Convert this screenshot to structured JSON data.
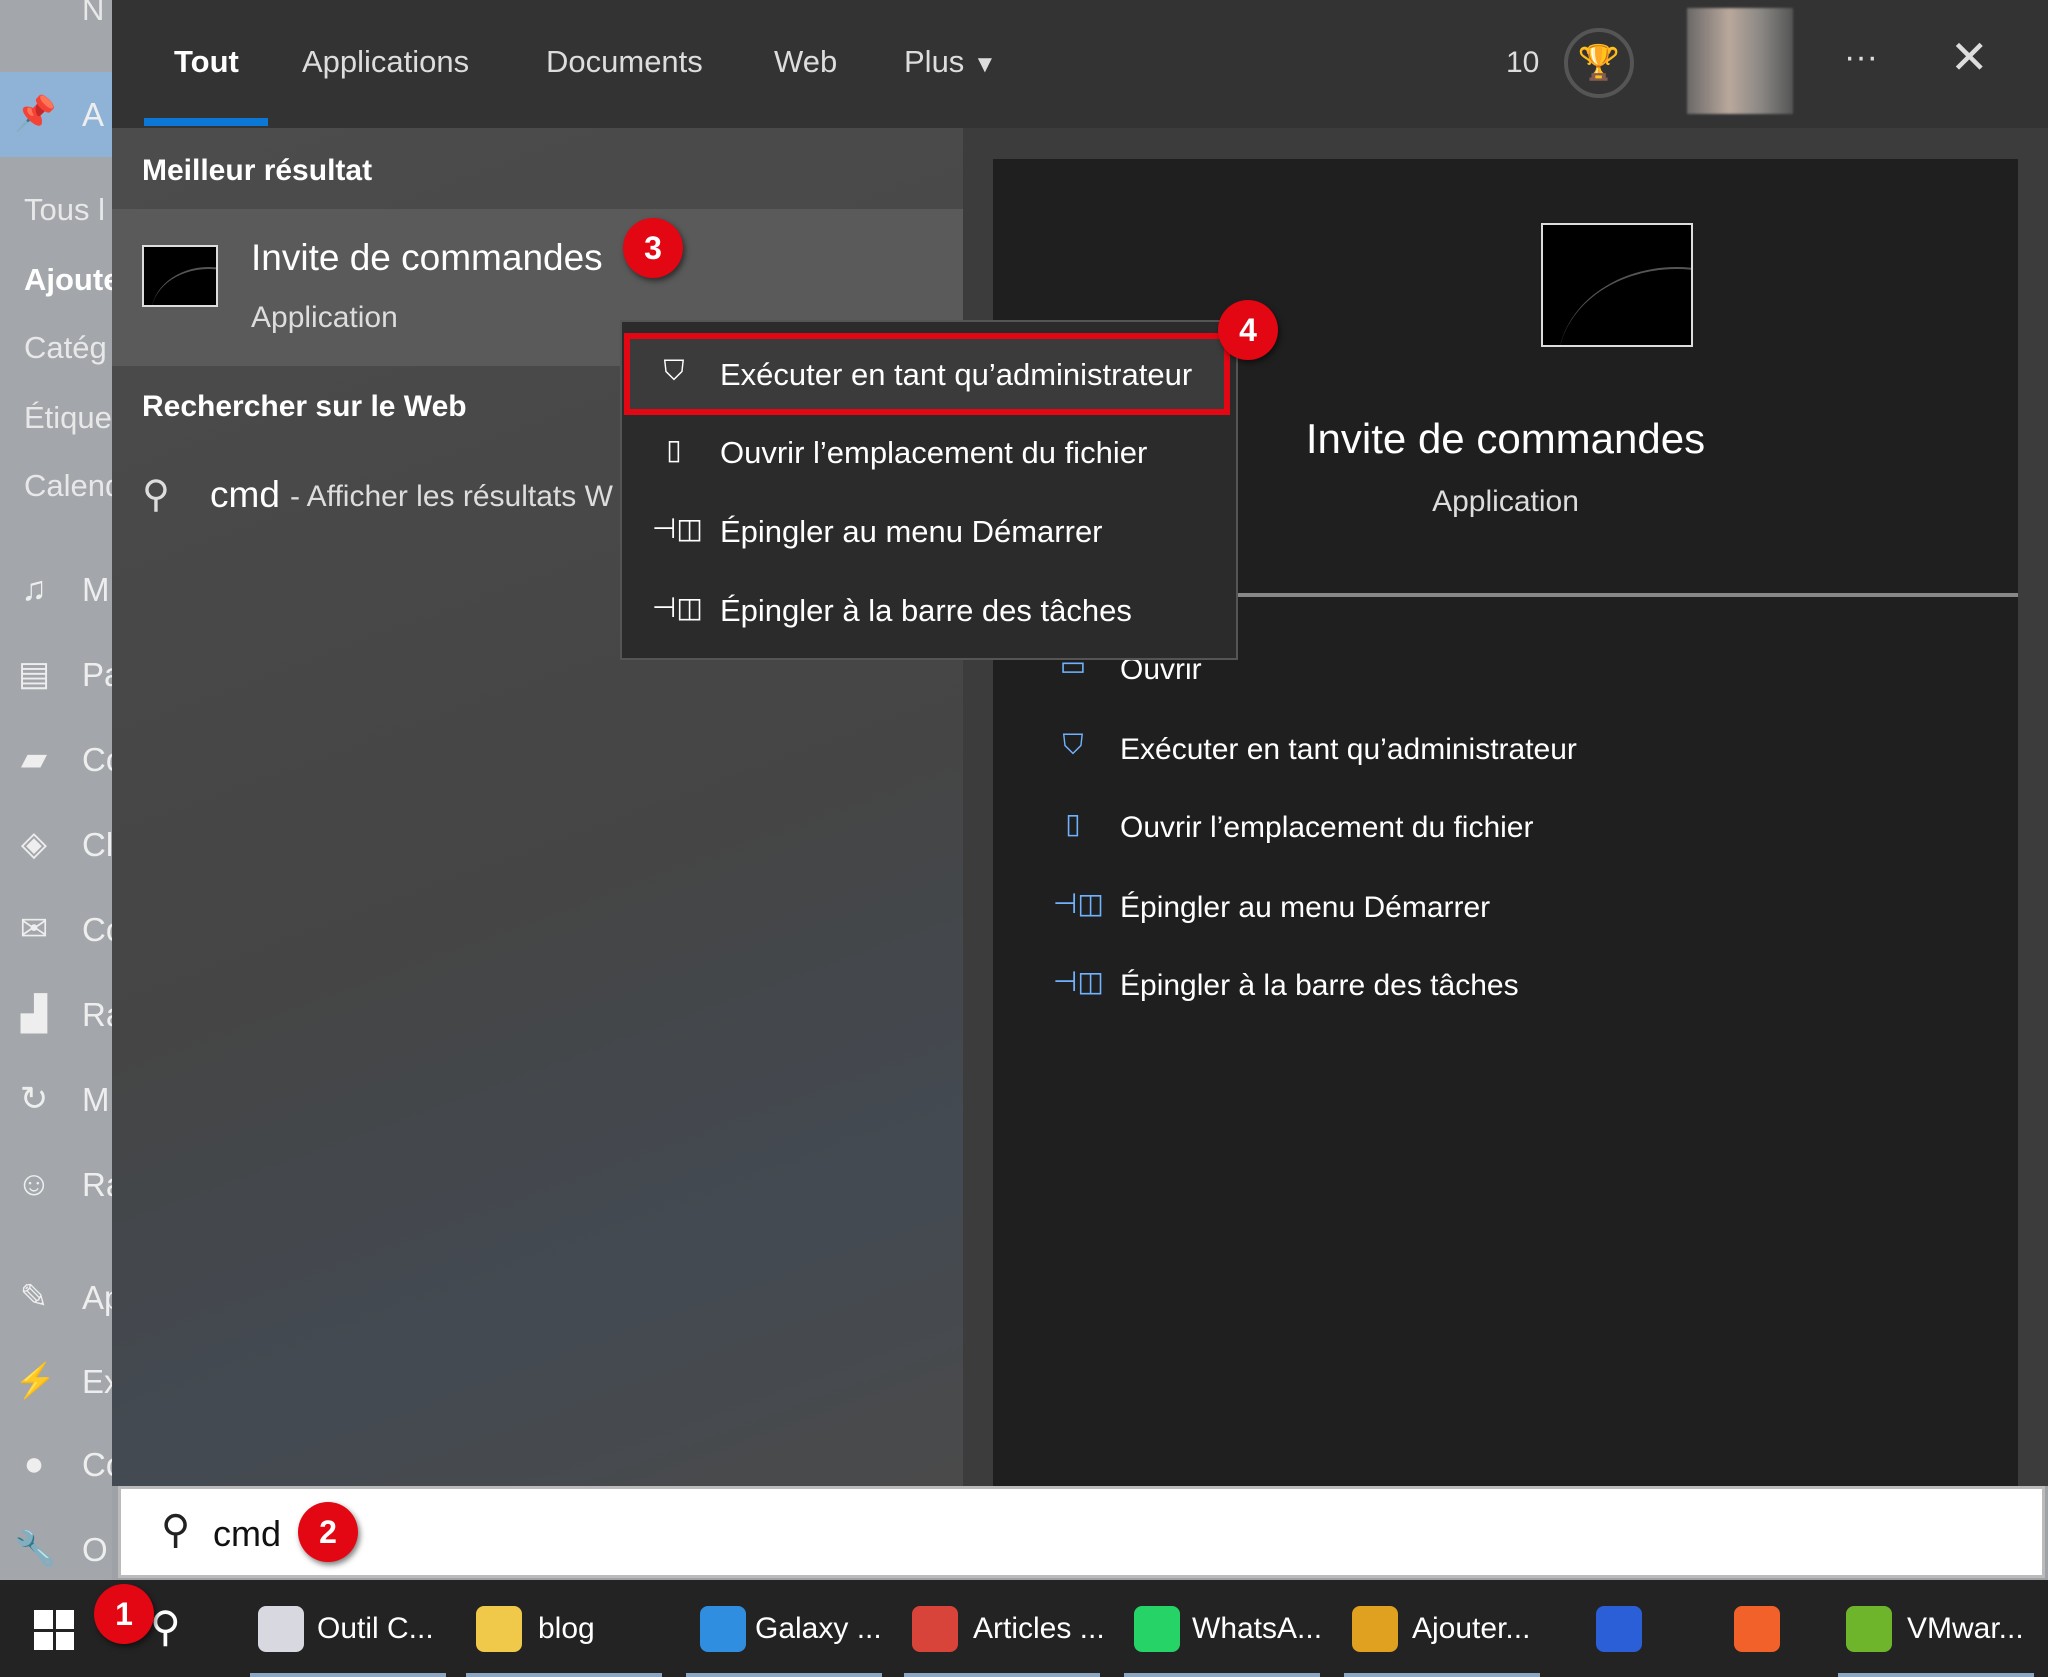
{
  "sidebar": {
    "top_item": "N",
    "highlighted": "A",
    "sub_items": [
      "Tous l",
      "Ajoute",
      "Catég",
      "Étique",
      "Calend"
    ],
    "items": [
      {
        "icon": "media-icon",
        "label": "M"
      },
      {
        "icon": "pages-icon",
        "label": "Pa"
      },
      {
        "icon": "comments-icon",
        "label": "Co"
      },
      {
        "icon": "plugin-icon",
        "label": "Cl"
      },
      {
        "icon": "mail-icon",
        "label": "Co"
      },
      {
        "icon": "chart-icon",
        "label": "Ra"
      },
      {
        "icon": "refresh-icon",
        "label": "M"
      },
      {
        "icon": "rabbit-icon",
        "label": "Ra"
      },
      {
        "icon": "appearance-icon",
        "label": "Ap"
      },
      {
        "icon": "plugins-icon",
        "label": "Ex"
      },
      {
        "icon": "user-icon",
        "label": "Co"
      },
      {
        "icon": "wrench-icon",
        "label": "O"
      }
    ]
  },
  "tabs": [
    {
      "label": "Tout",
      "active": true
    },
    {
      "label": "Applications"
    },
    {
      "label": "Documents"
    },
    {
      "label": "Web"
    },
    {
      "label": "Plus"
    }
  ],
  "header": {
    "points": "10",
    "accent": "#0a78d4"
  },
  "left": {
    "best_header": "Meilleur résultat",
    "best_title": "Invite de commandes",
    "best_sub": "Application",
    "web_header": "Rechercher sur le Web",
    "web_query": "cmd",
    "web_suffix": " - Afficher les résultats W"
  },
  "context_menu": [
    {
      "icon": "shield-icon",
      "label": "Exécuter en tant qu’administrateur",
      "highlighted": true
    },
    {
      "icon": "folder-icon",
      "label": "Ouvrir l’emplacement du fichier"
    },
    {
      "icon": "pin-icon",
      "label": "Épingler au menu Démarrer"
    },
    {
      "icon": "pin-icon",
      "label": "Épingler à la barre des tâches"
    }
  ],
  "preview": {
    "title": "Invite de commandes",
    "sub": "Application",
    "actions": [
      {
        "icon": "open-icon",
        "label": "Ouvrir"
      },
      {
        "icon": "shield-icon",
        "label": "Exécuter en tant qu’administrateur"
      },
      {
        "icon": "folder-icon",
        "label": "Ouvrir l’emplacement du fichier"
      },
      {
        "icon": "pin-icon",
        "label": "Épingler au menu Démarrer"
      },
      {
        "icon": "pin-icon",
        "label": "Épingler à la barre des tâches"
      }
    ]
  },
  "search": {
    "value": "cmd"
  },
  "badges": [
    "1",
    "2",
    "3",
    "4"
  ],
  "badge_color": "#e30613",
  "taskbar": [
    {
      "label": "Outil C...",
      "color": "#d8d8e0"
    },
    {
      "label": "blog",
      "color": "#f0c94a"
    },
    {
      "label": "Galaxy ...",
      "color": "#2f8ee0"
    },
    {
      "label": "Articles ...",
      "color": "#d9443a"
    },
    {
      "label": "WhatsA...",
      "color": "#25d366"
    },
    {
      "label": "Ajouter...",
      "color": "#e0a020"
    },
    {
      "label": "",
      "color": "#2a5fd8"
    },
    {
      "label": "",
      "color": "#f2612a"
    },
    {
      "label": "VMwar...",
      "color": "#6fb52c"
    }
  ]
}
